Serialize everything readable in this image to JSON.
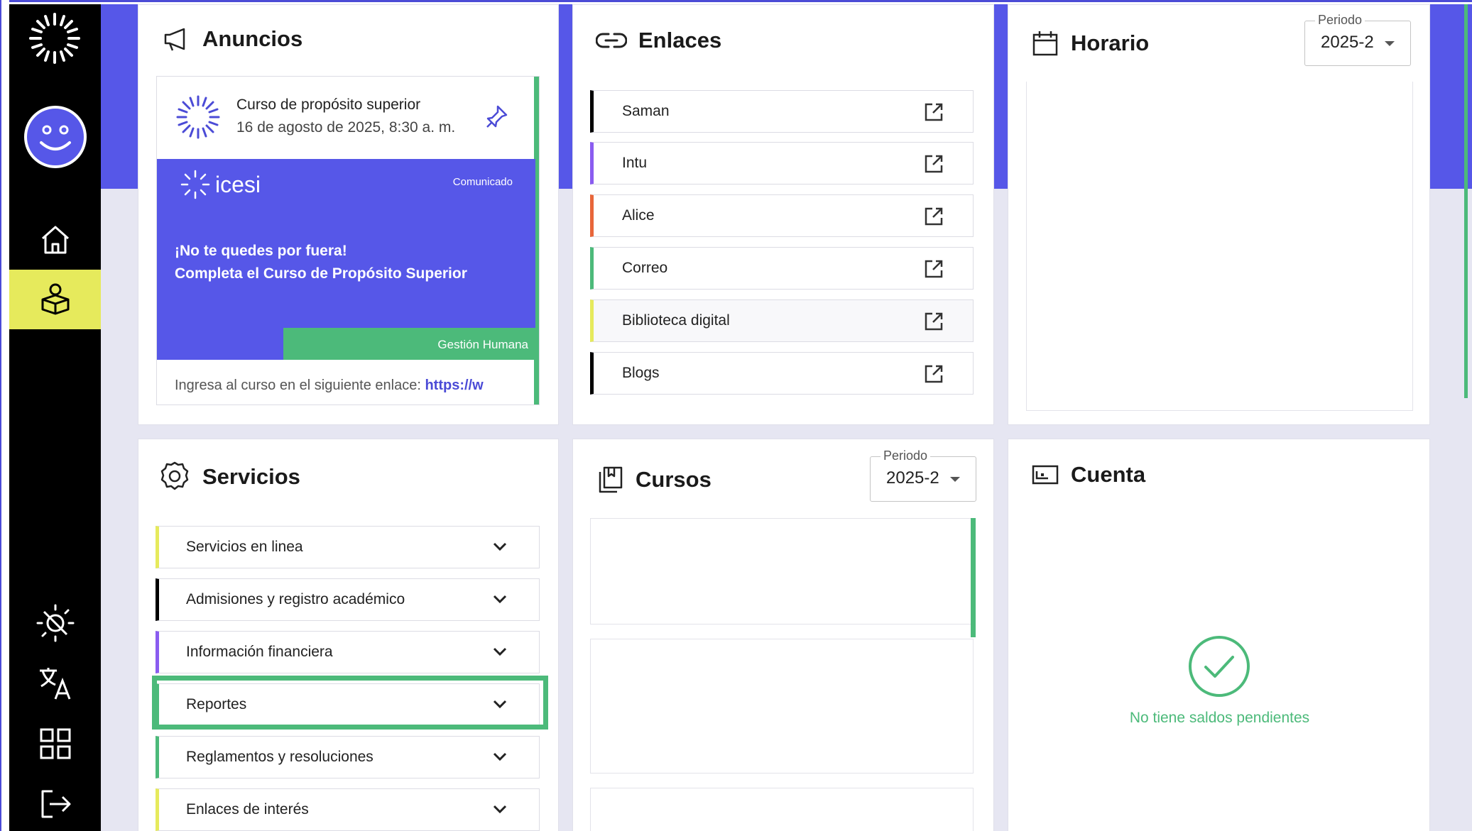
{
  "colors": {
    "accent": "#5657e8",
    "green": "#4cba7a",
    "yellow": "#e6ea5c",
    "purple": "#8a5cf0",
    "orange": "#e8663a",
    "black": "#000000"
  },
  "sidebar": {
    "items": [
      {
        "icon": "home-icon"
      },
      {
        "icon": "student-icon"
      },
      {
        "icon": "theme-toggle-icon"
      },
      {
        "icon": "translate-icon"
      },
      {
        "icon": "apps-grid-icon"
      },
      {
        "icon": "logout-icon"
      }
    ]
  },
  "announcements": {
    "title": "Anuncios",
    "item": {
      "title": "Curso de propósito superior",
      "date": "16 de agosto de 2025, 8:30 a. m.",
      "brand": "icesi",
      "tag": "Comunicado",
      "headline_1": "¡No te quedes por fuera!",
      "headline_2": "Completa el Curso de Propósito Superior",
      "footer": "Gestión Humana",
      "body": "Ingresa al curso en el siguiente enlace: ",
      "link": "https://w"
    }
  },
  "links": {
    "title": "Enlaces",
    "items": [
      {
        "label": "Saman",
        "color": "#000000"
      },
      {
        "label": "Intu",
        "color": "#8a5cf0"
      },
      {
        "label": "Alice",
        "color": "#e8663a"
      },
      {
        "label": "Correo",
        "color": "#4cba7a"
      },
      {
        "label": "Biblioteca digital",
        "color": "#e6ea5c"
      },
      {
        "label": "Blogs",
        "color": "#000000"
      }
    ]
  },
  "schedule": {
    "title": "Horario",
    "period_label": "Periodo",
    "period_value": "2025-2"
  },
  "services": {
    "title": "Servicios",
    "items": [
      {
        "label": "Servicios en linea",
        "color": "#e6ea5c"
      },
      {
        "label": "Admisiones y registro académico",
        "color": "#000000"
      },
      {
        "label": "Información financiera",
        "color": "#8a5cf0"
      },
      {
        "label": "Reportes",
        "color": "#4cba7a"
      },
      {
        "label": "Reglamentos y resoluciones",
        "color": "#4cba7a"
      },
      {
        "label": "Enlaces de interés",
        "color": "#e6ea5c"
      }
    ]
  },
  "courses": {
    "title": "Cursos",
    "period_label": "Periodo",
    "period_value": "2025-2"
  },
  "account": {
    "title": "Cuenta",
    "status": "No tiene saldos pendientes"
  }
}
